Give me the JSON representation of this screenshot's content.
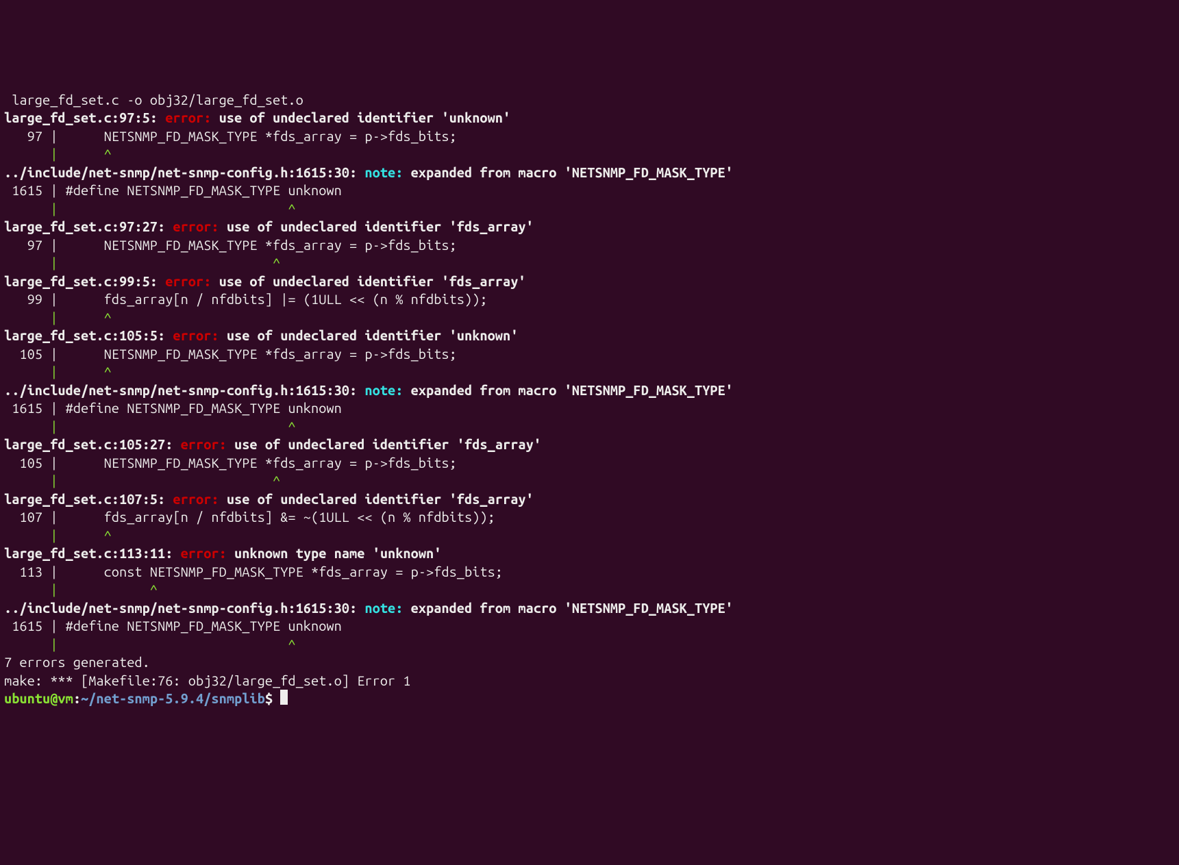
{
  "cc_line": " large_fd_set.c -o obj32/large_fd_set.o",
  "err1_loc": "large_fd_set.c:97:5: ",
  "err1_tag": "error: ",
  "err1_msg": "use of undeclared identifier 'unknown'",
  "err1_code": "   97 |      NETSNMP_FD_MASK_TYPE *fds_array = p->fds_bits;",
  "err1_caret": "      |      ^",
  "note1_loc": "../include/net-snmp/net-snmp-config.h:1615:30: ",
  "note1_tag": "note: ",
  "note1_msg": "expanded from macro 'NETSNMP_FD_MASK_TYPE'",
  "note1_code": " 1615 | #define NETSNMP_FD_MASK_TYPE unknown",
  "note1_caret": "      |                              ^",
  "err2_loc": "large_fd_set.c:97:27: ",
  "err2_tag": "error: ",
  "err2_msg": "use of undeclared identifier 'fds_array'",
  "err2_code": "   97 |      NETSNMP_FD_MASK_TYPE *fds_array = p->fds_bits;",
  "err2_caret": "      |                            ^",
  "err3_loc": "large_fd_set.c:99:5: ",
  "err3_tag": "error: ",
  "err3_msg": "use of undeclared identifier 'fds_array'",
  "err3_code": "   99 |      fds_array[n / nfdbits] |= (1ULL << (n % nfdbits));",
  "err3_caret": "      |      ^",
  "err4_loc": "large_fd_set.c:105:5: ",
  "err4_tag": "error: ",
  "err4_msg": "use of undeclared identifier 'unknown'",
  "err4_code": "  105 |      NETSNMP_FD_MASK_TYPE *fds_array = p->fds_bits;",
  "err4_caret": "      |      ^",
  "note2_loc": "../include/net-snmp/net-snmp-config.h:1615:30: ",
  "note2_tag": "note: ",
  "note2_msg": "expanded from macro 'NETSNMP_FD_MASK_TYPE'",
  "note2_code": " 1615 | #define NETSNMP_FD_MASK_TYPE unknown",
  "note2_caret": "      |                              ^",
  "err5_loc": "large_fd_set.c:105:27: ",
  "err5_tag": "error: ",
  "err5_msg": "use of undeclared identifier 'fds_array'",
  "err5_code": "  105 |      NETSNMP_FD_MASK_TYPE *fds_array = p->fds_bits;",
  "err5_caret": "      |                            ^",
  "err6_loc": "large_fd_set.c:107:5: ",
  "err6_tag": "error: ",
  "err6_msg": "use of undeclared identifier 'fds_array'",
  "err6_code": "  107 |      fds_array[n / nfdbits] &= ~(1ULL << (n % nfdbits));",
  "err6_caret": "      |      ^",
  "err7_loc": "large_fd_set.c:113:11: ",
  "err7_tag": "error: ",
  "err7_msg": "unknown type name 'unknown'",
  "err7_code": "  113 |      const NETSNMP_FD_MASK_TYPE *fds_array = p->fds_bits;",
  "err7_caret": "      |            ^",
  "note3_loc": "../include/net-snmp/net-snmp-config.h:1615:30: ",
  "note3_tag": "note: ",
  "note3_msg": "expanded from macro 'NETSNMP_FD_MASK_TYPE'",
  "note3_code": " 1615 | #define NETSNMP_FD_MASK_TYPE unknown",
  "note3_caret": "      |                              ^",
  "summary": "7 errors generated.",
  "make_err": "make: *** [Makefile:76: obj32/large_fd_set.o] Error 1",
  "prompt_user": "ubuntu@vm",
  "prompt_sep": ":",
  "prompt_path": "~/net-snmp-5.9.4/snmplib",
  "prompt_end": "$ "
}
